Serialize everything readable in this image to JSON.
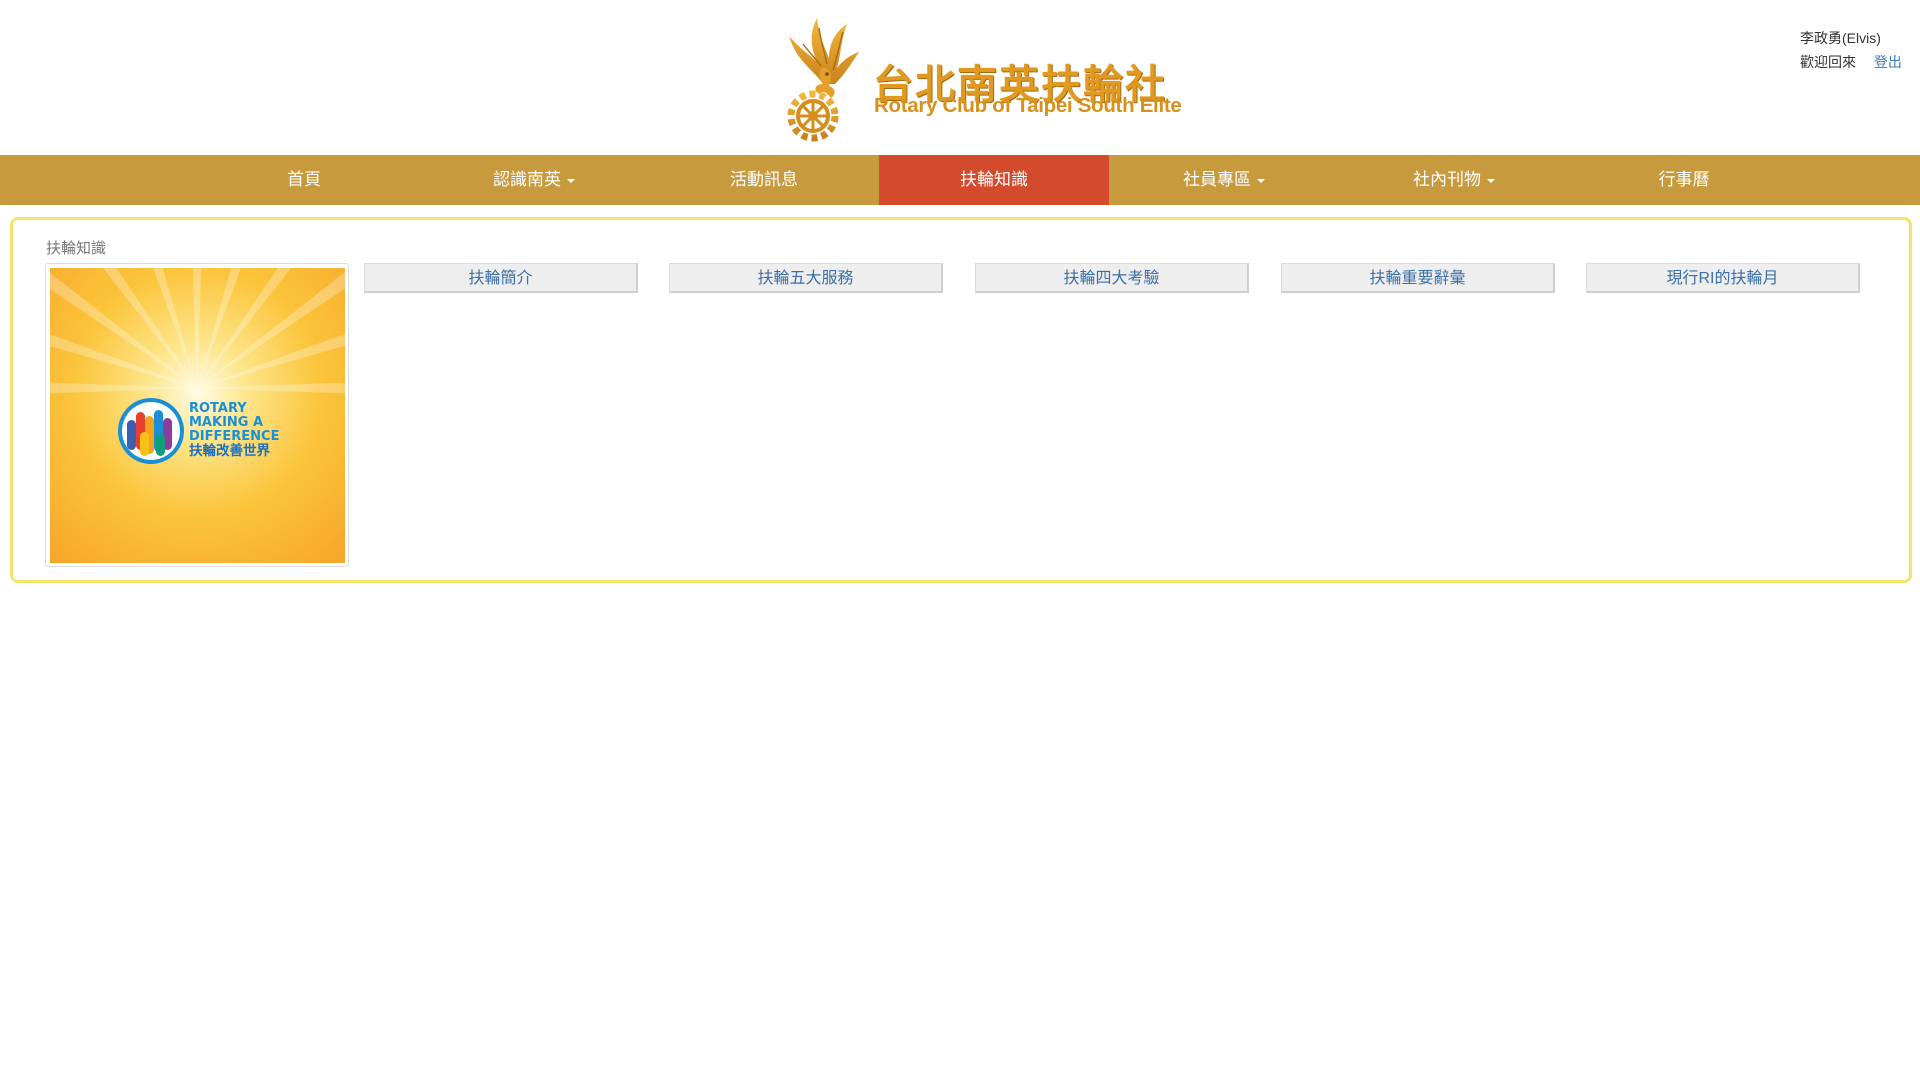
{
  "brand": {
    "name_cn": "台北南英扶輪社",
    "name_en": "Rotary Club of Taipei South Elite",
    "color_gold": "#e09a20"
  },
  "user": {
    "name": "李政勇(Elvis)",
    "welcome": "歡迎回來",
    "logout": "登出"
  },
  "nav": {
    "items": [
      {
        "label": "首頁",
        "dropdown": false
      },
      {
        "label": "認識南英",
        "dropdown": true
      },
      {
        "label": "活動訊息",
        "dropdown": false
      },
      {
        "label": "扶輪知識",
        "dropdown": false,
        "active": true
      },
      {
        "label": "社員專區",
        "dropdown": true
      },
      {
        "label": "社內刊物",
        "dropdown": true
      },
      {
        "label": "行事曆",
        "dropdown": false
      }
    ],
    "bg_color": "#c79a3e",
    "active_color": "#d34a2d"
  },
  "main": {
    "breadcrumb": "扶輪知識",
    "image": {
      "line1": "ROTARY",
      "line2": "MAKING A",
      "line3": "DIFFERENCE",
      "line4": "扶輪改善世界"
    },
    "topics": [
      "扶輪簡介",
      "扶輪五大服務",
      "扶輪四大考驗",
      "扶輪重要辭彙",
      "現行RI的扶輪月"
    ],
    "panel_border_color": "#f6e46a"
  }
}
